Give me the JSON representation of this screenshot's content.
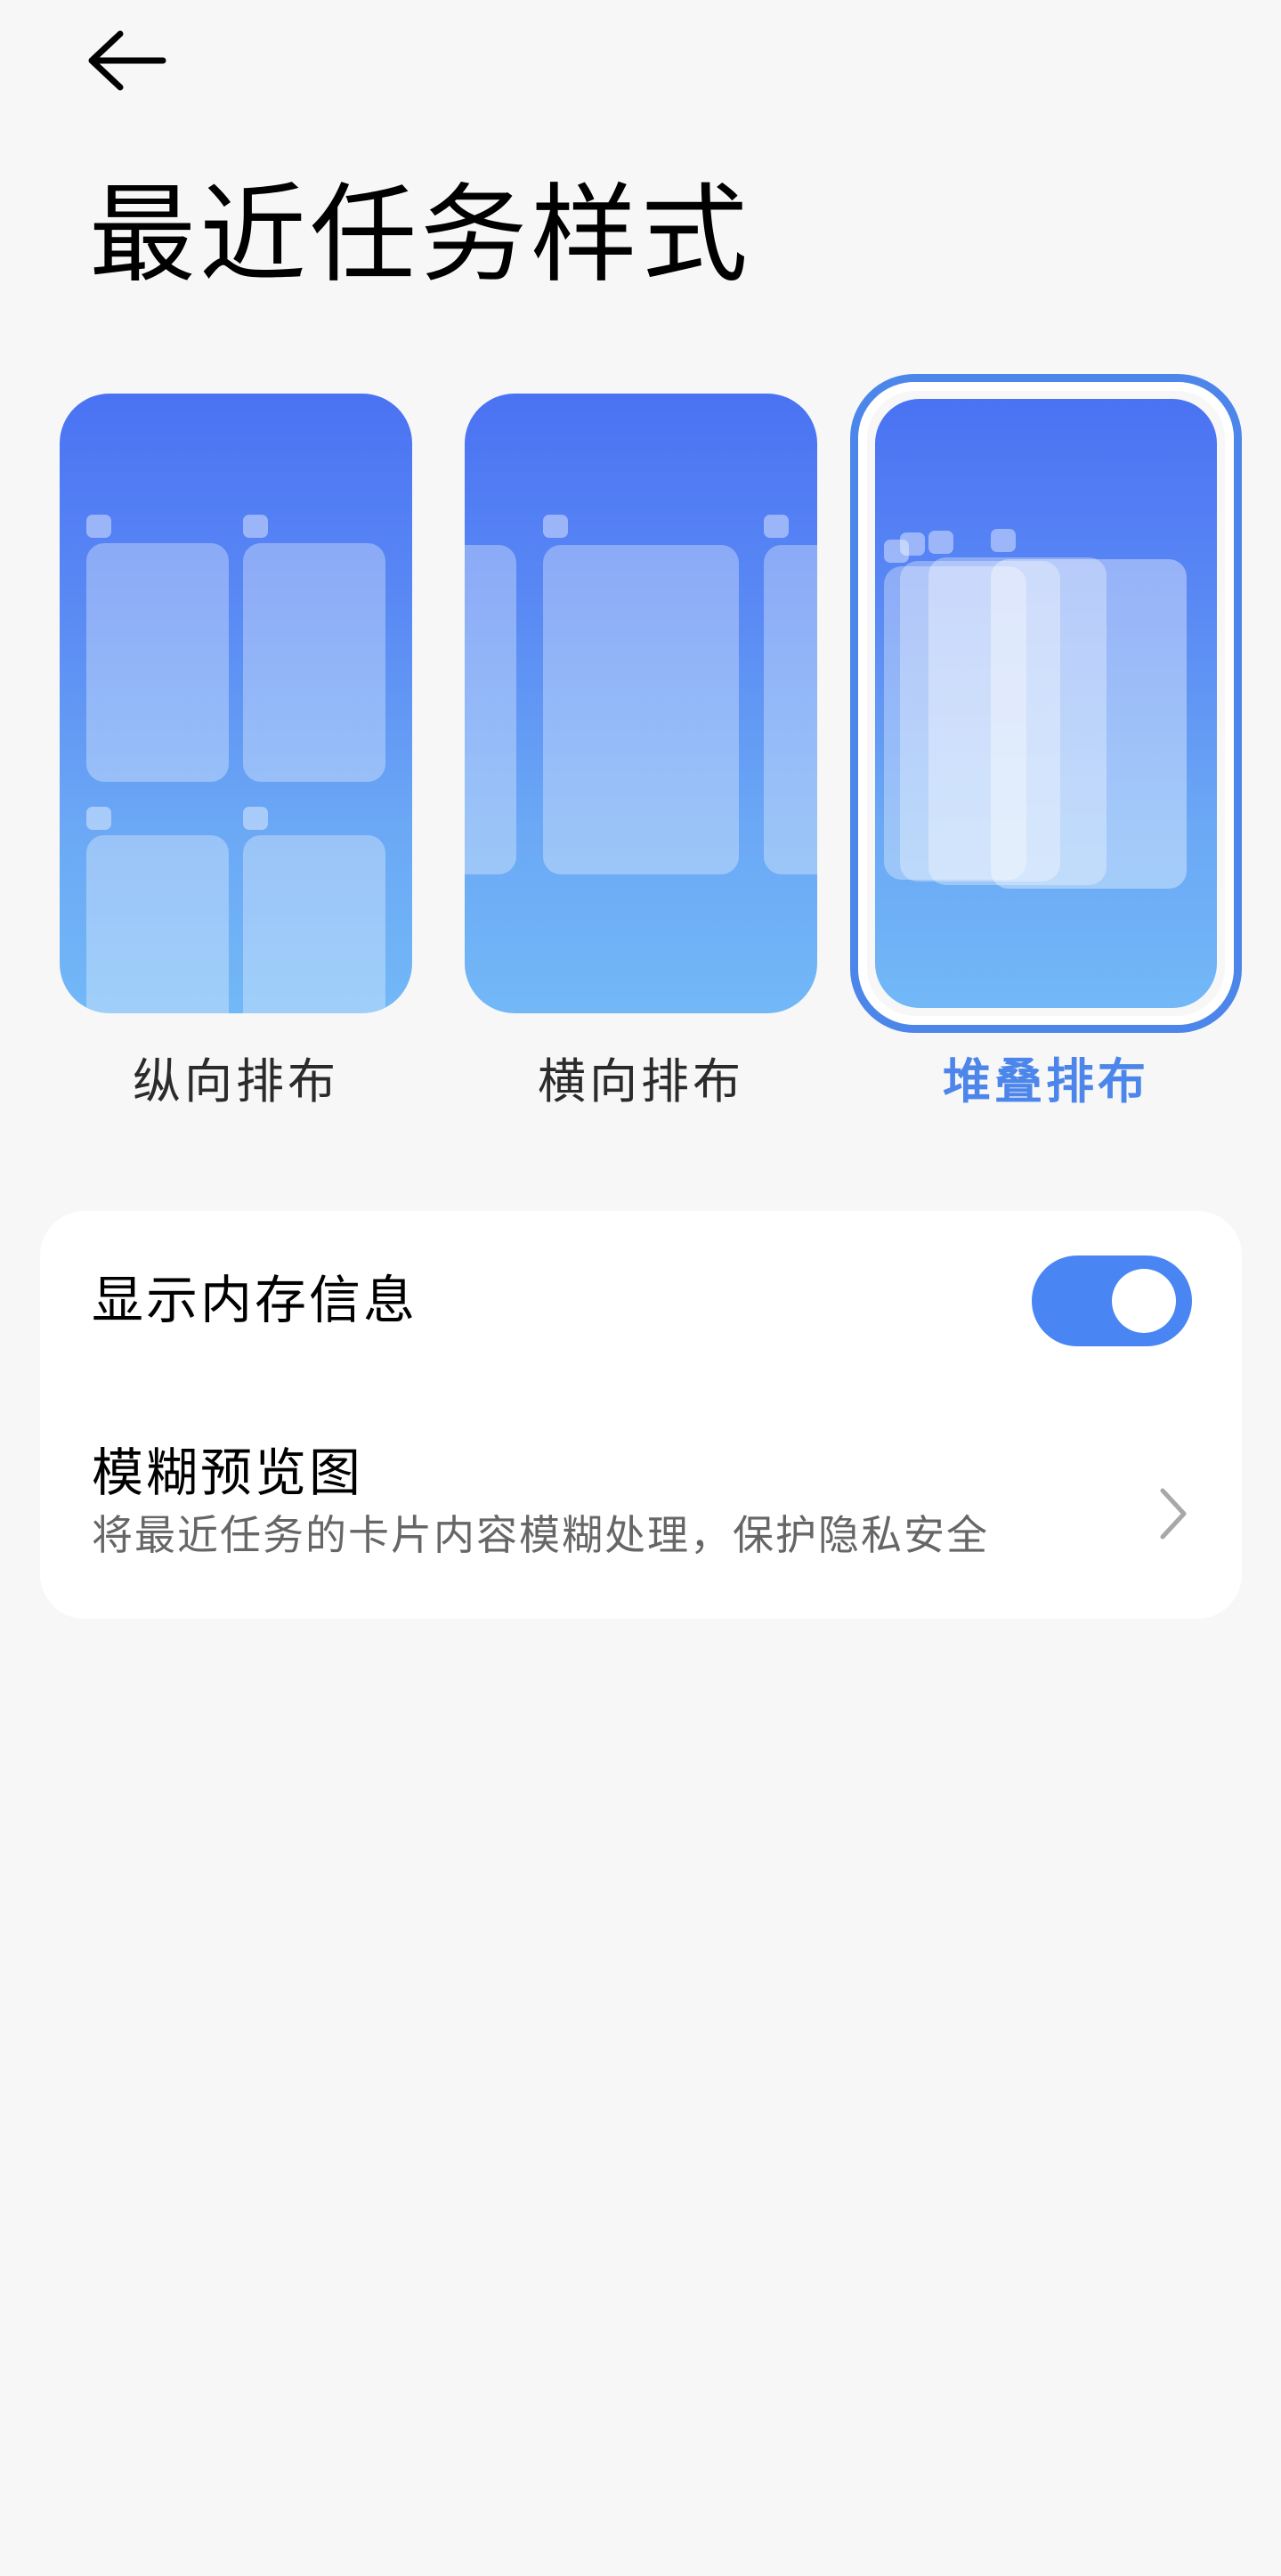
{
  "header": {
    "back_icon": "arrow-left-icon",
    "title": "最近任务样式"
  },
  "layouts": {
    "selected": "stacked",
    "options": [
      {
        "id": "vertical",
        "label": "纵向排布"
      },
      {
        "id": "horizontal",
        "label": "横向排布"
      },
      {
        "id": "stacked",
        "label": "堆叠排布"
      }
    ]
  },
  "settings": {
    "memory": {
      "label": "显示内存信息",
      "enabled": true
    },
    "blur": {
      "label": "模糊预览图",
      "description": "将最近任务的卡片内容模糊处理，保护隐私安全",
      "icon": "chevron-right-icon"
    }
  },
  "colors": {
    "accent": "#4d86ea",
    "toggle_on": "#4a85f4",
    "background": "#f7f7f7",
    "preview_top": "#4a72f3",
    "preview_bottom": "#72b8f7"
  }
}
